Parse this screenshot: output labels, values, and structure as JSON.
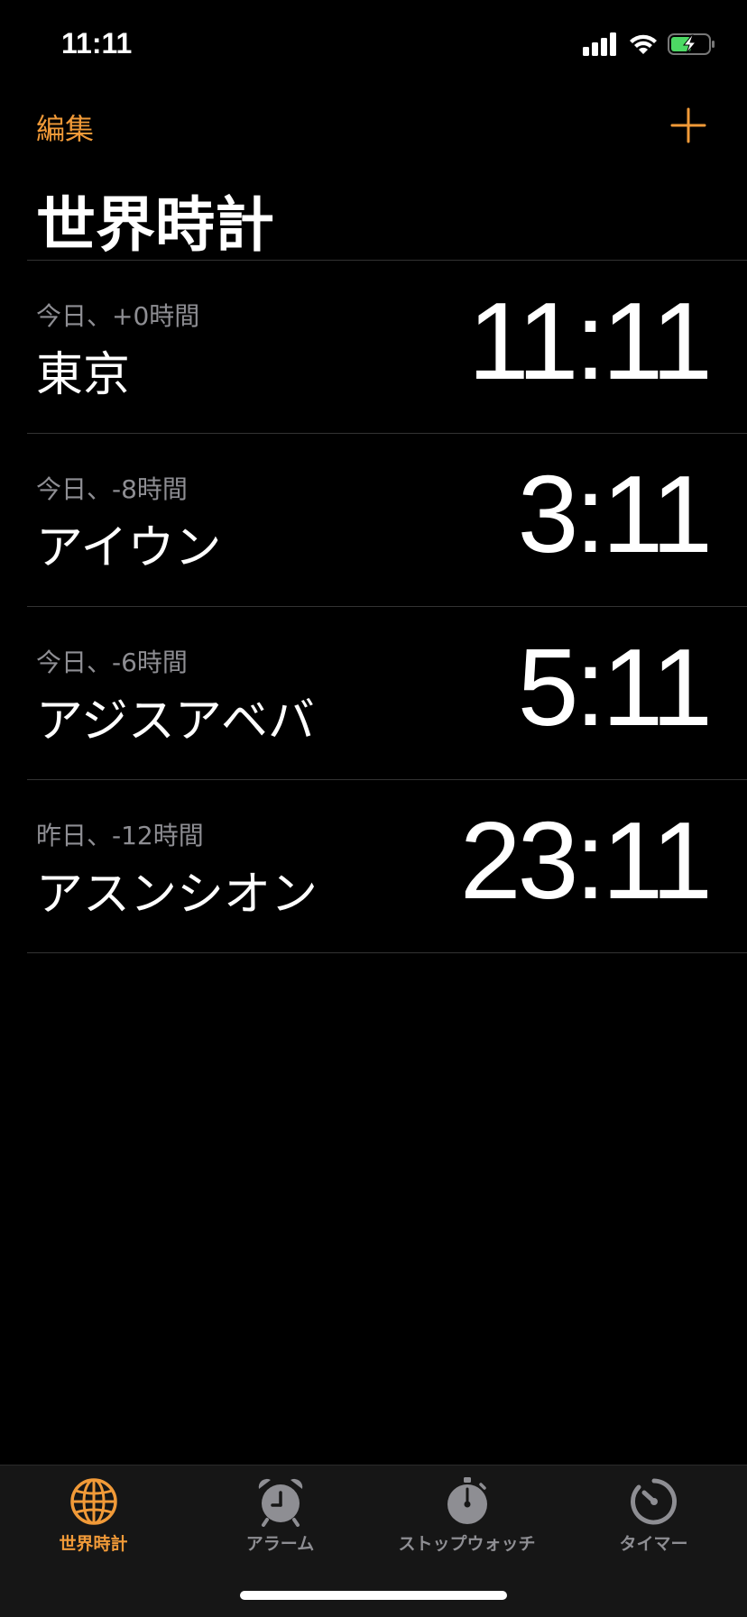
{
  "status_bar": {
    "time": "11:11",
    "icons": [
      "cellular-signal-icon",
      "wifi-icon",
      "battery-charging-icon"
    ]
  },
  "header": {
    "edit_label": "編集",
    "add_icon": "plus-icon",
    "title": "世界時計"
  },
  "clocks": [
    {
      "offset": "今日、+0時間",
      "city": "東京",
      "time": "11:11"
    },
    {
      "offset": "今日、-8時間",
      "city": "アイウン",
      "time": "3:11"
    },
    {
      "offset": "今日、-6時間",
      "city": "アジスアベバ",
      "time": "5:11"
    },
    {
      "offset": "昨日、-12時間",
      "city": "アスンシオン",
      "time": "23:11"
    }
  ],
  "tabs": [
    {
      "label": "世界時計",
      "icon": "globe-icon",
      "active": true
    },
    {
      "label": "アラーム",
      "icon": "alarm-clock-icon",
      "active": false
    },
    {
      "label": "ストップウォッチ",
      "icon": "stopwatch-icon",
      "active": false
    },
    {
      "label": "タイマー",
      "icon": "timer-icon",
      "active": false
    }
  ],
  "colors": {
    "accent": "#f19a38",
    "secondary_text": "#8e8e93",
    "background": "#000000",
    "tab_bar": "#161616",
    "battery_fill": "#4cd964"
  }
}
